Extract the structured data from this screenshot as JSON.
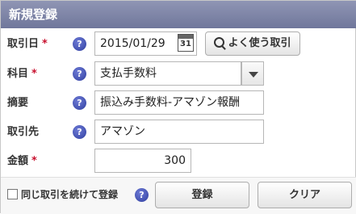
{
  "dialog": {
    "title": "新規登録"
  },
  "form": {
    "date": {
      "label": "取引日",
      "required": "*",
      "value": "2015/01/29",
      "calendar_day": "31"
    },
    "frequent_button": "よく使う取引",
    "category": {
      "label": "科目",
      "required": "*",
      "value": "支払手数料"
    },
    "summary": {
      "label": "摘要",
      "value": "振込み手数料-アマゾン報酬"
    },
    "partner": {
      "label": "取引先",
      "value": "アマゾン"
    },
    "amount": {
      "label": "金額",
      "required": "*",
      "value": "300"
    },
    "help_glyph": "?"
  },
  "footer": {
    "continue_label": "同じ取引を続けて登録",
    "register_button": "登録",
    "clear_button": "クリア"
  },
  "colors": {
    "titlebar": "#7a80a4",
    "required": "#c8102e",
    "help": "#3243b0"
  },
  "icons": [
    "help-icon",
    "calendar-icon",
    "search-icon",
    "dropdown-arrow-icon"
  ]
}
